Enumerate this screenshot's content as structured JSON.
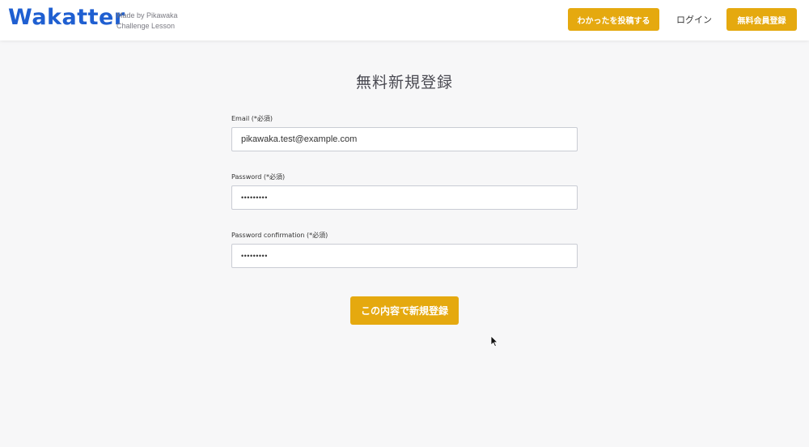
{
  "header": {
    "logo": "Wakatter",
    "tagline_line1": "Made by Pikawaka",
    "tagline_line2": "Challenge Lesson",
    "post_button": "わかったを投稿する",
    "login_link": "ログイン",
    "signup_button": "無料会員登録"
  },
  "form": {
    "title": "無料新規登録",
    "email_label": "Email (*必須)",
    "email_value": "pikawaka.test@example.com",
    "password_label": "Password (*必須)",
    "password_value": "•••••••••",
    "password_confirmation_label": "Password confirmation (*必須)",
    "password_confirmation_value": "•••••••••",
    "submit_label": "この内容で新規登録"
  },
  "colors": {
    "accent": "#e5a90f",
    "logo": "#1f5fd1"
  },
  "icons": {
    "cursor": "mouse-pointer-icon"
  }
}
